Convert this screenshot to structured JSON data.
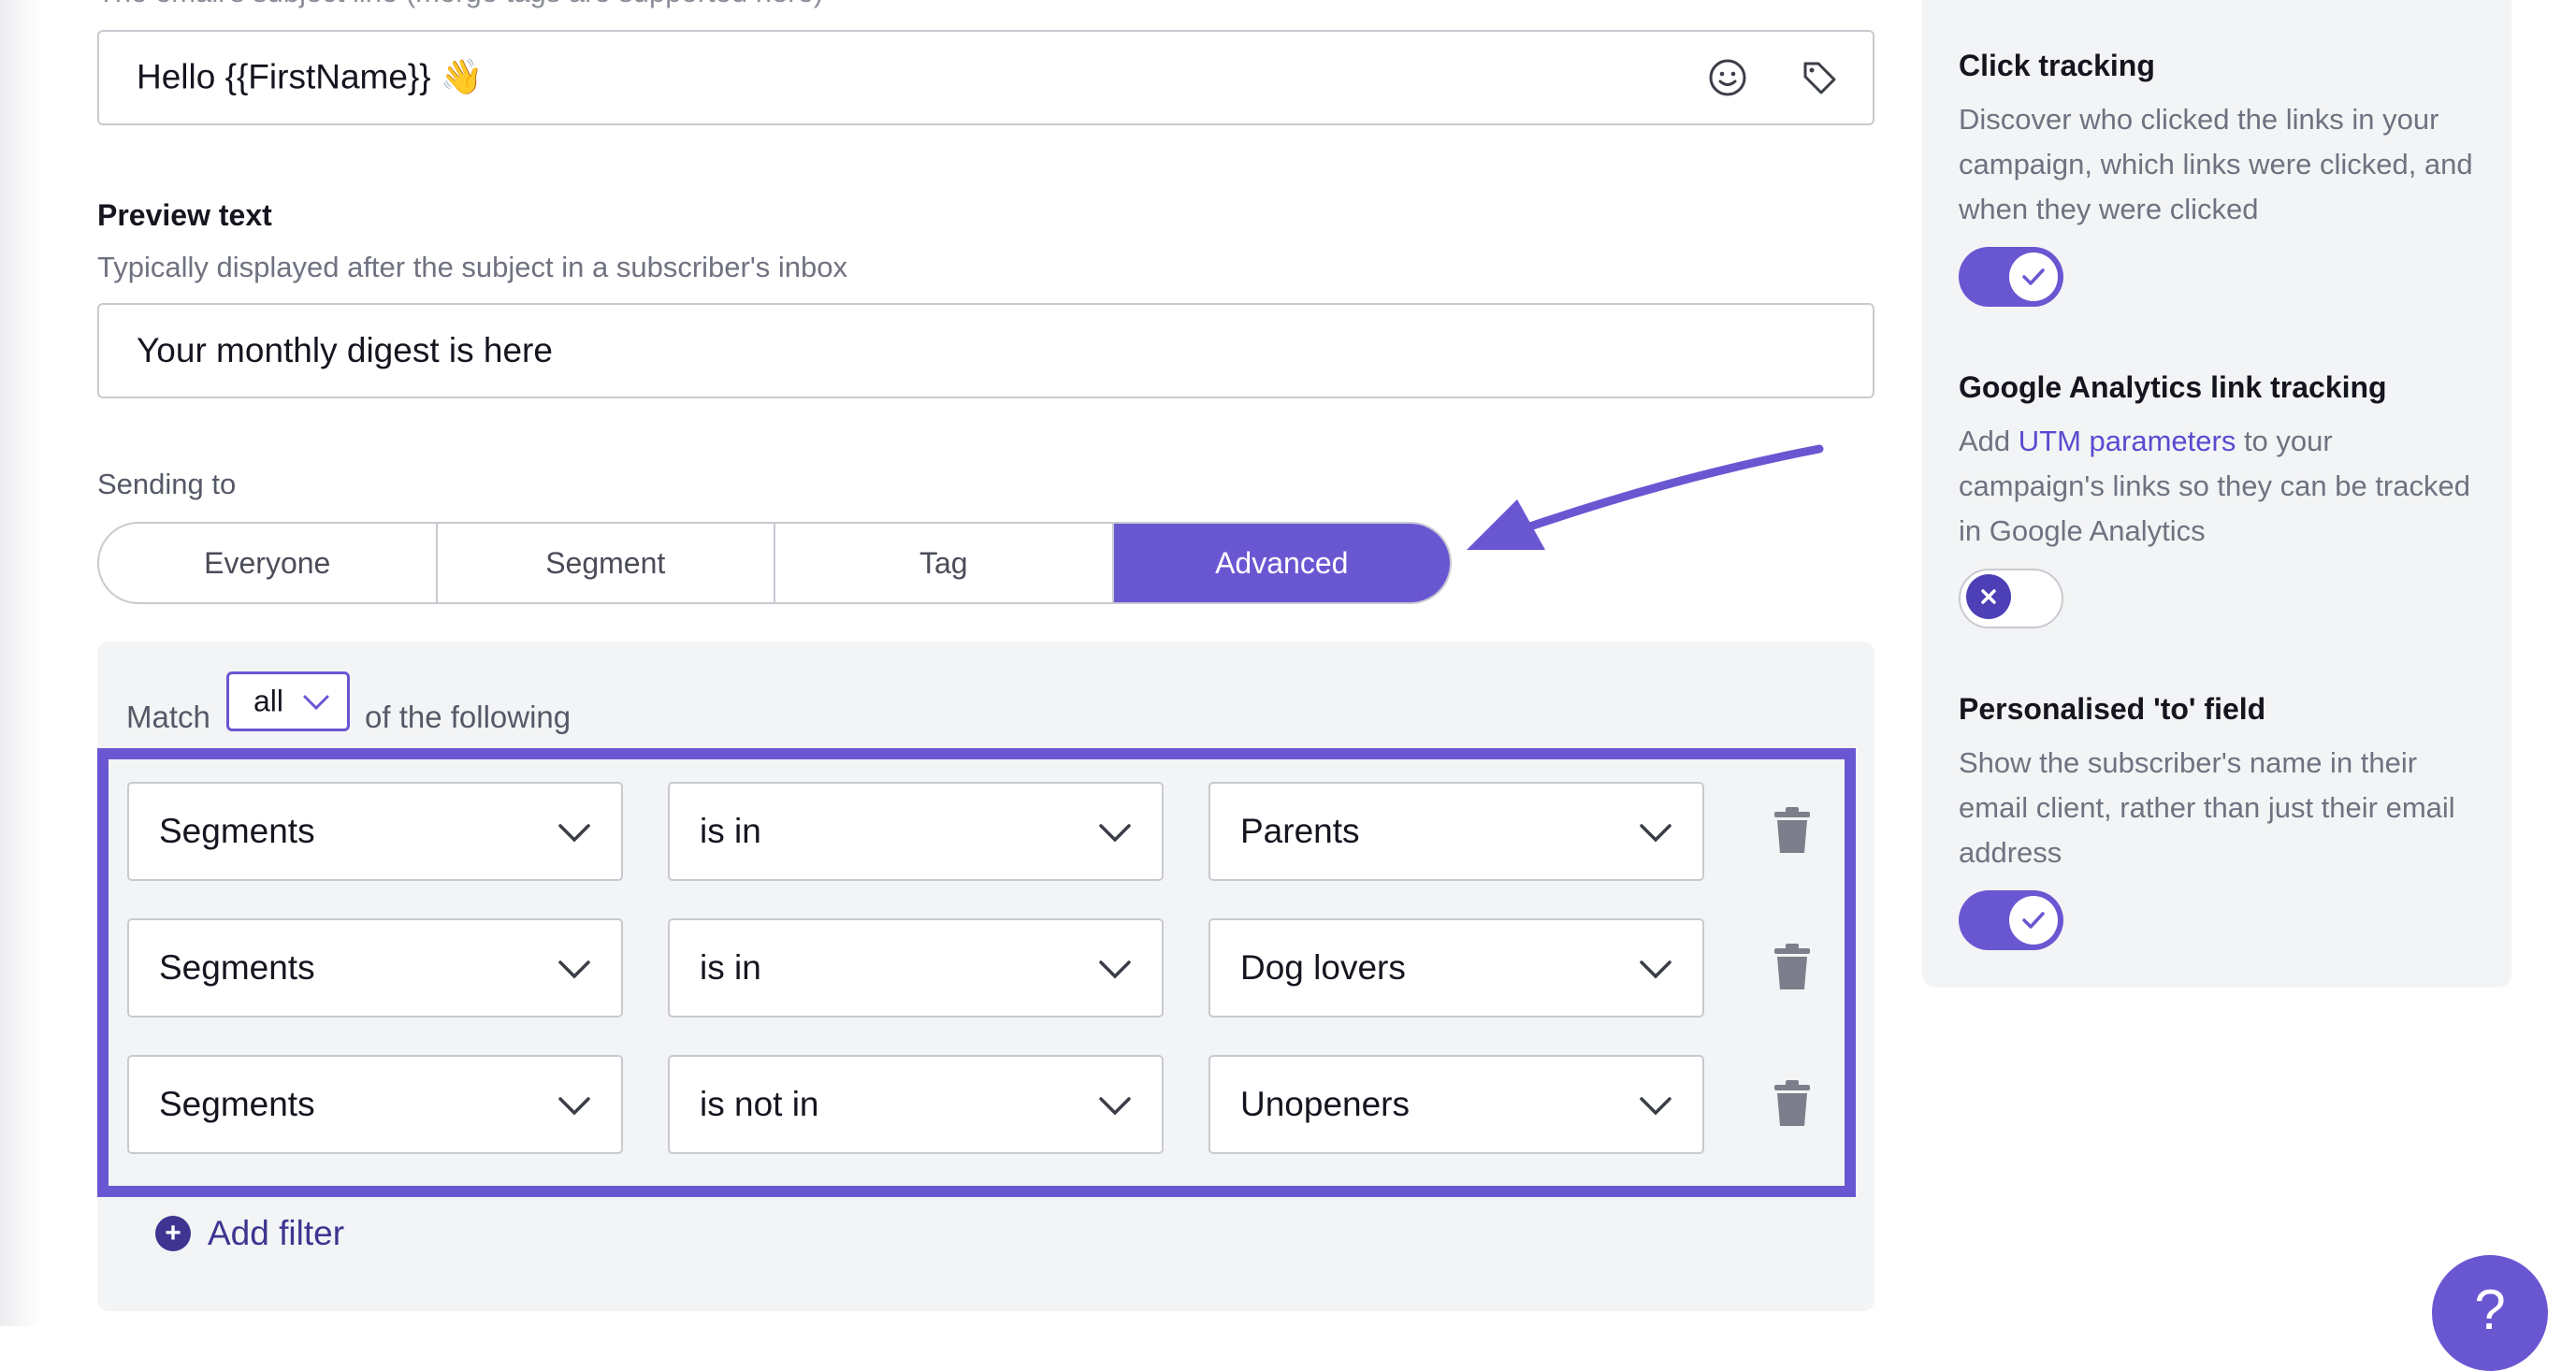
{
  "subject": {
    "hint": "The email's subject line (merge tags are supported here)",
    "value": "Hello {{FirstName}} 👋"
  },
  "preview": {
    "label": "Preview text",
    "hint": "Typically displayed after the subject in a subscriber's inbox",
    "value": "Your monthly digest is here"
  },
  "sending_to": {
    "label": "Sending to",
    "options": [
      "Everyone",
      "Segment",
      "Tag",
      "Advanced"
    ],
    "selected": "Advanced"
  },
  "filters": {
    "match_prefix": "Match",
    "match_value": "all",
    "match_suffix": "of the following",
    "rows": [
      {
        "field": "Segments",
        "operator": "is in",
        "value": "Parents"
      },
      {
        "field": "Segments",
        "operator": "is in",
        "value": "Dog lovers"
      },
      {
        "field": "Segments",
        "operator": "is not in",
        "value": "Unopeners"
      }
    ],
    "add_label": "Add filter"
  },
  "options": {
    "click_tracking": {
      "title": "Click tracking",
      "description": "Discover who clicked the links in your campaign, which links were clicked, and when they were clicked",
      "enabled": true
    },
    "ga_tracking": {
      "title": "Google Analytics link tracking",
      "desc_pre": "Add ",
      "desc_link": "UTM parameters",
      "desc_post": " to your campaign's links so they can be tracked in Google Analytics",
      "enabled": false
    },
    "personalised_to": {
      "title": "Personalised 'to' field",
      "description": "Show the subscriber's name in their email client, rather than just their email address",
      "enabled": true
    }
  },
  "help": {
    "label": "?"
  },
  "colors": {
    "accent": "#6957d2",
    "accent_dark": "#3e3491",
    "panel_bg": "#f3f4f5",
    "border": "#c8cad0"
  },
  "icons": {
    "emoji": "smiley-icon",
    "tag": "tag-icon",
    "chevron": "chevron-down-icon",
    "delete": "trash-icon",
    "add": "plus-circle-icon",
    "toggle_on": "check-icon",
    "toggle_off": "x-icon",
    "help": "question-icon"
  }
}
